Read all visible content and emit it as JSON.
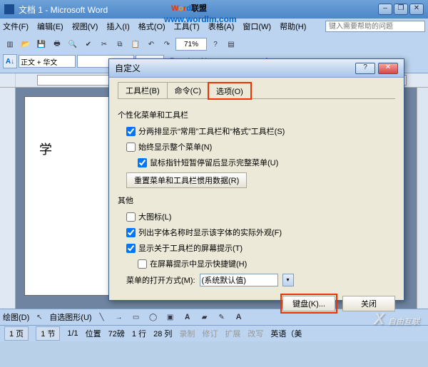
{
  "window": {
    "title": "文档 1 - Microsoft Word"
  },
  "watermark": {
    "brand": "Word联盟",
    "url": "www.wordlm.com",
    "footer": "自由互联"
  },
  "menubar": {
    "file": "文件(F)",
    "edit": "编辑(E)",
    "view": "视图(V)",
    "insert": "插入(I)",
    "format": "格式(O)",
    "tools": "工具(T)",
    "table": "表格(A)",
    "window": "窗口(W)",
    "help": "帮助(H)",
    "help_placeholder": "键入需要帮助的问题"
  },
  "toolbars": {
    "zoom": "71%",
    "style": "正文 + 华文",
    "font": "",
    "size": ""
  },
  "document": {
    "text": "学"
  },
  "drawbar": {
    "label": "绘图(D)",
    "autoshape": "自选图形(U)"
  },
  "status": {
    "page": "1 页",
    "section": "1 节",
    "pageof": "1/1",
    "position_label": "位置",
    "position_value": "72磅",
    "line_label": "1 行",
    "col_label": "28 列",
    "rec": "录制",
    "rev": "修订",
    "ext": "扩展",
    "ovr": "改写",
    "lang": "英语（美"
  },
  "dialog": {
    "title": "自定义",
    "tabs": {
      "toolbars": "工具栏(B)",
      "commands": "命令(C)",
      "options": "选项(O)"
    },
    "group1": "个性化菜单和工具栏",
    "opt_two_rows": "分两排显示“常用”工具栏和“格式”工具栏(S)",
    "opt_full_menu": "始终显示整个菜单(N)",
    "opt_hover_full": "鼠标指针短暂停留后显示完整菜单(U)",
    "reset_btn": "重置菜单和工具栏惯用数据(R)",
    "group2": "其他",
    "opt_large_icons": "大图标(L)",
    "opt_font_preview": "列出字体名称时显示该字体的实际外观(F)",
    "opt_tooltips": "显示关于工具栏的屏幕提示(T)",
    "opt_shortcut_in_tip": "在屏幕提示中显示快捷键(H)",
    "menu_anim_label": "菜单的打开方式(M):",
    "menu_anim_value": "(系统默认值)",
    "btn_keyboard": "键盘(K)...",
    "btn_close": "关闭"
  }
}
